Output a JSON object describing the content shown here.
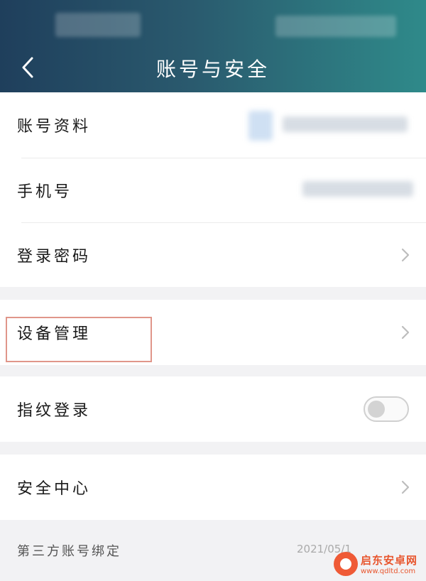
{
  "header": {
    "title": "账号与安全",
    "back_icon": "chevron-left-icon"
  },
  "rows": {
    "account_profile": "账号资料",
    "phone": "手机号",
    "login_password": "登录密码",
    "device_management": "设备管理",
    "fingerprint_login": "指纹登录",
    "security_center": "安全中心"
  },
  "fingerprint_toggle": {
    "on": false
  },
  "section": {
    "third_party_binding": "第三方账号绑定",
    "date_partial": "2021/05/1"
  },
  "watermark": {
    "name": "启东安卓网",
    "url": "www.qdltd.com"
  },
  "colors": {
    "header_left": "#1f3f5c",
    "header_right": "#2f8a8a",
    "highlight_border": "#e0968a",
    "watermark": "#e8562e"
  }
}
